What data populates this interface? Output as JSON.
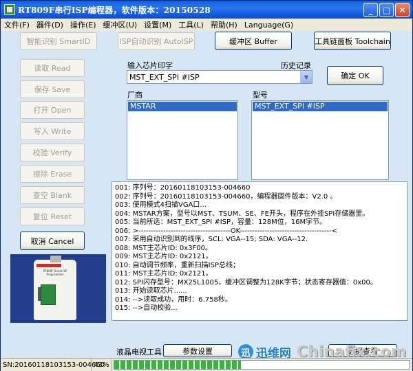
{
  "window": {
    "title": "RT809F串行ISP编程器，软件版本：20150528",
    "controls": {
      "minimize": "_",
      "maximize": "□",
      "close": "✕"
    }
  },
  "menu": [
    "文件(F)",
    "器件(D)",
    "操作(E)",
    "缓冲区(U)",
    "设置(M)",
    "工具(L)",
    "帮助(H)",
    "Language(G)"
  ],
  "toolbar": {
    "smart_id": "智能识别 SmartID",
    "isp_auto": "ISP自动识别 AutoISP",
    "buffer": "缓冲区 Buffer",
    "toolchain": "工具链面板 Toolchain"
  },
  "left_actions": {
    "read": "读取 Read",
    "save": "保存 Save",
    "open": "打开 Open",
    "write": "写入 Write",
    "verify": "校验 Verify",
    "erase": "擦除 Erase",
    "blank": "查空 Blank",
    "reset": "复位 Reset",
    "cancel": "取消 Cancel"
  },
  "chip_input": {
    "label": "输入芯片印字",
    "history_label": "历史记录",
    "value": "MST_EXT_SPI #ISP",
    "confirm": "确定 OK"
  },
  "manufacturer": {
    "label": "厂商",
    "selected": "MSTAR"
  },
  "model": {
    "label": "型号",
    "selected": "MST_EXT_SPI #ISP"
  },
  "log": [
    "001: 序列号：20160118103153-004660",
    "002: 序列号：20160118103153-004660，编程器固件版本：V2.0 。",
    "003: 使用模式4扫描VGA口...",
    "004: MSTAR方案，型号以MST、TSUM、SE、FE开头，程序在外挂SPI存储器里。",
    "005: 当前所选：MST_EXT_SPI #ISP，容量：128M位，16M字节。",
    "006: >-------------------------------------OK-------------------------------------<",
    "007: 采用自动识别到的线序，SCL: VGA--15; SDA: VGA--12.",
    "008: MST主芯片ID: 0x3F00。",
    "009: MST主芯片ID: 0x2121。",
    "010: 自动调节频率，重新扫描ISP总线；",
    "011: MST主芯片ID: 0x2121。",
    "012: SPI闪存型号：MX25L1005，缓冲区调整为128K字节；状态寄存器值：0x00。",
    "013: 开始读取芯片......",
    "014: -->读取成功，用时：6.758秒。",
    "015: -->自动校验..."
  ],
  "photo": {
    "label_text": "RT809F Serial ISP Programmer"
  },
  "bottom": {
    "lcd_tool_label": "液晶电视工具",
    "params": "参数设置",
    "data_view": "数据查看"
  },
  "status": {
    "sn": "SN:20160118103153-004660",
    "percent": "43%",
    "progress_fraction": 0.43
  },
  "watermark": {
    "icon": "迅",
    "cn": "迅维网",
    "en": "Chinafix.com"
  },
  "colors": {
    "selection": "#316ac5",
    "progress": "#37b737",
    "title": "#0a5fe0"
  }
}
